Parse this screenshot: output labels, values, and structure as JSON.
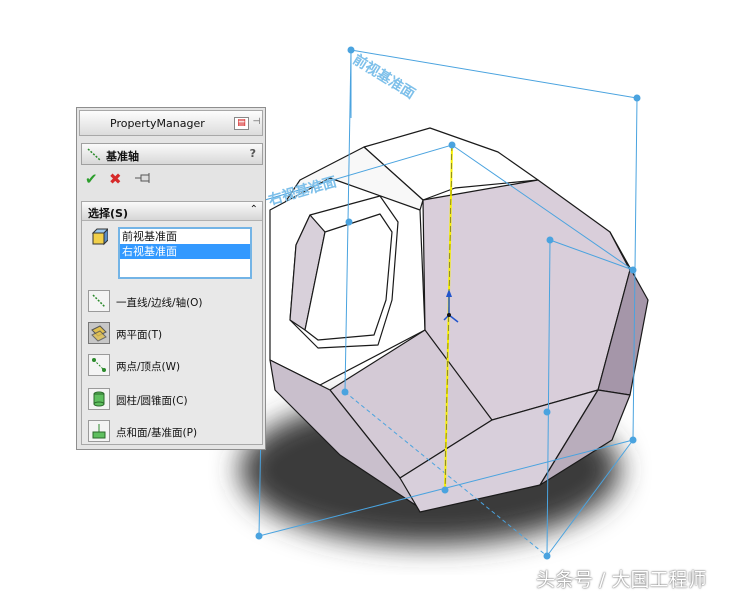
{
  "panel": {
    "title": "PropertyManager",
    "feature_title": "基准轴",
    "help": "?",
    "selection_section": {
      "title": "选择(S)",
      "items": [
        {
          "label": "前视基准面",
          "selected": false
        },
        {
          "label": "右视基准面",
          "selected": true
        }
      ]
    },
    "options": [
      {
        "label": "一直线/边线/轴(O)",
        "icon": "line-edge-axis-icon",
        "active": false
      },
      {
        "label": "两平面(T)",
        "icon": "two-planes-icon",
        "active": true
      },
      {
        "label": "两点/顶点(W)",
        "icon": "two-points-icon",
        "active": false
      },
      {
        "label": "圆柱/圆锥面(C)",
        "icon": "cylinder-cone-icon",
        "active": false
      },
      {
        "label": "点和面/基准面(P)",
        "icon": "point-plane-icon",
        "active": false
      }
    ]
  },
  "viewport": {
    "plane_labels": {
      "front": "前视基准面",
      "right": "右视基准面"
    },
    "colors": {
      "plane": "#4aa3df",
      "axis": "#f7f000",
      "face": "#d6cbd8",
      "top_face": "#ffffff"
    }
  },
  "watermark": "头条号 / 大国工程师"
}
